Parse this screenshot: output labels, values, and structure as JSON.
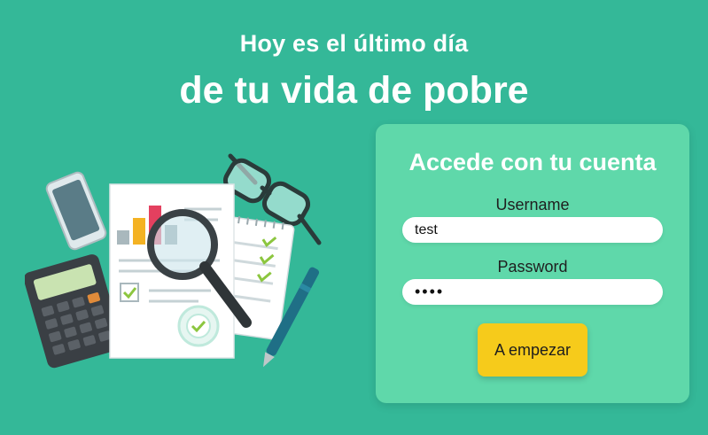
{
  "header": {
    "line1": "Hoy es el último día",
    "line2": "de tu vida de pobre"
  },
  "login": {
    "title": "Accede con tu cuenta",
    "username_label": "Username",
    "username_value": "test",
    "password_label": "Password",
    "password_value": "test",
    "submit_label": "A empezar"
  },
  "illustration": {
    "icons": [
      "smartphone-icon",
      "calculator-icon",
      "document-icon",
      "magnifying-glass-icon",
      "notepad-icon",
      "glasses-icon",
      "pen-icon",
      "check-badge-icon"
    ]
  },
  "colors": {
    "background": "#34b898",
    "card": "#5fd8aa",
    "button": "#f6cb1b",
    "text_light": "#ffffff"
  }
}
